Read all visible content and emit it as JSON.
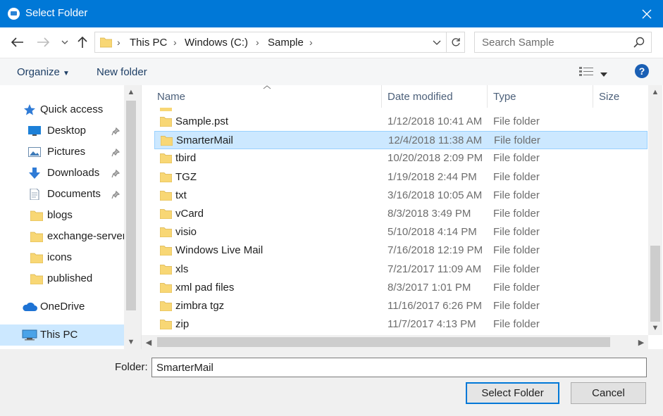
{
  "window": {
    "title": "Select Folder"
  },
  "address": {
    "crumbs": [
      "This PC",
      "Windows (C:)",
      "Sample"
    ]
  },
  "search": {
    "placeholder": "Search Sample"
  },
  "toolbar": {
    "organize": "Organize",
    "new_folder": "New folder",
    "help": "?"
  },
  "nav": {
    "items": [
      {
        "label": "Quick access",
        "icon": "star-icon",
        "pinned": false
      },
      {
        "label": "Desktop",
        "icon": "desktop-icon",
        "pinned": true
      },
      {
        "label": "Pictures",
        "icon": "pictures-icon",
        "pinned": true
      },
      {
        "label": "Downloads",
        "icon": "download-arrow-icon",
        "pinned": true
      },
      {
        "label": "Documents",
        "icon": "document-icon",
        "pinned": true
      },
      {
        "label": "blogs",
        "icon": "folder-icon",
        "pinned": false
      },
      {
        "label": "exchange-server",
        "icon": "folder-icon",
        "pinned": false
      },
      {
        "label": "icons",
        "icon": "folder-icon",
        "pinned": false
      },
      {
        "label": "published",
        "icon": "folder-icon",
        "pinned": false
      },
      {
        "label": "OneDrive",
        "icon": "cloud-icon",
        "pinned": false
      },
      {
        "label": "This PC",
        "icon": "computer-icon",
        "pinned": false,
        "selected": true
      }
    ]
  },
  "columns": {
    "name": "Name",
    "date": "Date modified",
    "type": "Type",
    "size": "Size"
  },
  "files": [
    {
      "name": "Sample.pst",
      "date": "1/12/2018 10:41 AM",
      "type": "File folder"
    },
    {
      "name": "SmarterMail",
      "date": "12/4/2018 11:38 AM",
      "type": "File folder",
      "selected": true
    },
    {
      "name": "tbird",
      "date": "10/20/2018 2:09 PM",
      "type": "File folder"
    },
    {
      "name": "TGZ",
      "date": "1/19/2018 2:44 PM",
      "type": "File folder"
    },
    {
      "name": "txt",
      "date": "3/16/2018 10:05 AM",
      "type": "File folder"
    },
    {
      "name": "vCard",
      "date": "8/3/2018 3:49 PM",
      "type": "File folder"
    },
    {
      "name": "visio",
      "date": "5/10/2018 4:14 PM",
      "type": "File folder"
    },
    {
      "name": "Windows Live Mail",
      "date": "7/16/2018 12:19 PM",
      "type": "File folder"
    },
    {
      "name": "xls",
      "date": "7/21/2017 11:09 AM",
      "type": "File folder"
    },
    {
      "name": "xml pad files",
      "date": "8/3/2017 1:01 PM",
      "type": "File folder"
    },
    {
      "name": "zimbra tgz",
      "date": "11/16/2017 6:26 PM",
      "type": "File folder"
    },
    {
      "name": "zip",
      "date": "11/7/2017 4:13 PM",
      "type": "File folder"
    }
  ],
  "folder_field": {
    "label": "Folder:",
    "value": "SmarterMail"
  },
  "buttons": {
    "select": "Select Folder",
    "cancel": "Cancel"
  },
  "colors": {
    "accent": "#0078d7",
    "selection": "#cce8ff",
    "folder": "#f8d775"
  }
}
